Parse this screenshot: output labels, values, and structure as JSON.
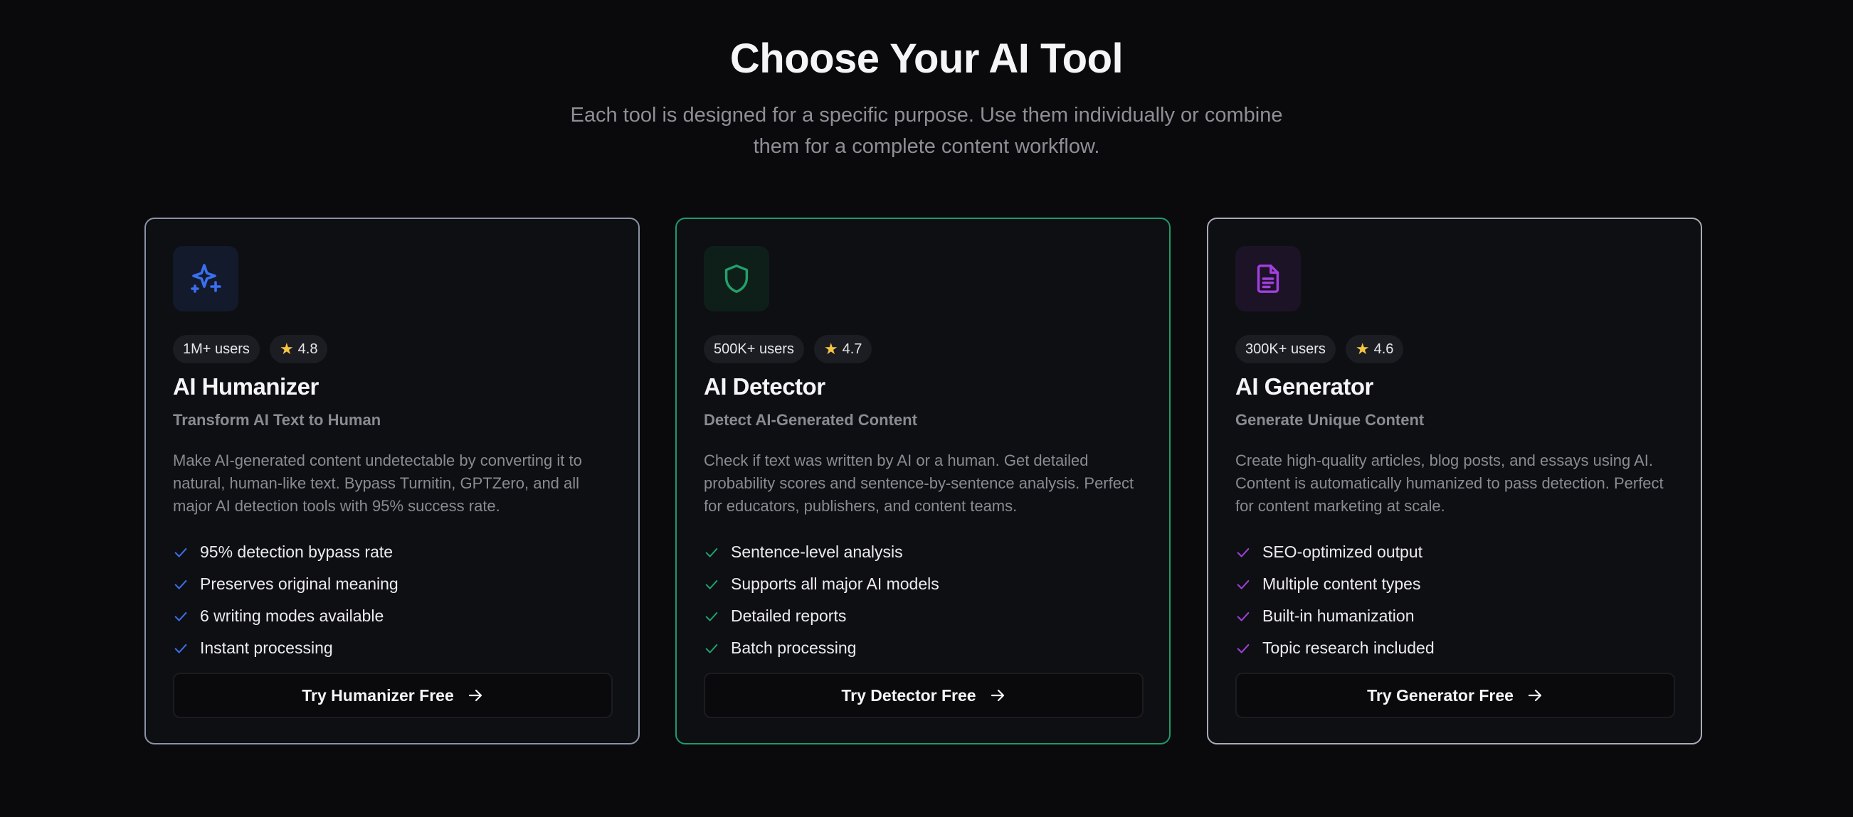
{
  "header": {
    "title": "Choose Your AI Tool",
    "subtitle": "Each tool is designed for a specific purpose. Use them individually or combine them for a complete content workflow."
  },
  "colors": {
    "humanizer_accent": "#3b6ff0",
    "detector_accent": "#22a06b",
    "generator_accent": "#a33fe0"
  },
  "cards": [
    {
      "icon": "sparkle-icon",
      "users": "1M+ users",
      "rating": "4.8",
      "title": "AI Humanizer",
      "subtitle": "Transform AI Text to Human",
      "description": "Make AI-generated content undetectable by converting it to natural, human-like text. Bypass Turnitin, GPTZero, and all major AI detection tools with 95% success rate.",
      "features": [
        "95% detection bypass rate",
        "Preserves original meaning",
        "6 writing modes available",
        "Instant processing"
      ],
      "cta": "Try Humanizer Free"
    },
    {
      "icon": "shield-icon",
      "users": "500K+ users",
      "rating": "4.7",
      "title": "AI Detector",
      "subtitle": "Detect AI-Generated Content",
      "description": "Check if text was written by AI or a human. Get detailed probability scores and sentence-by-sentence analysis. Perfect for educators, publishers, and content teams.",
      "features": [
        "Sentence-level analysis",
        "Supports all major AI models",
        "Detailed reports",
        "Batch processing"
      ],
      "cta": "Try Detector Free"
    },
    {
      "icon": "document-icon",
      "users": "300K+ users",
      "rating": "4.6",
      "title": "AI Generator",
      "subtitle": "Generate Unique Content",
      "description": "Create high-quality articles, blog posts, and essays using AI. Content is automatically humanized to pass detection. Perfect for content marketing at scale.",
      "features": [
        "SEO-optimized output",
        "Multiple content types",
        "Built-in humanization",
        "Topic research included"
      ],
      "cta": "Try Generator Free"
    }
  ]
}
